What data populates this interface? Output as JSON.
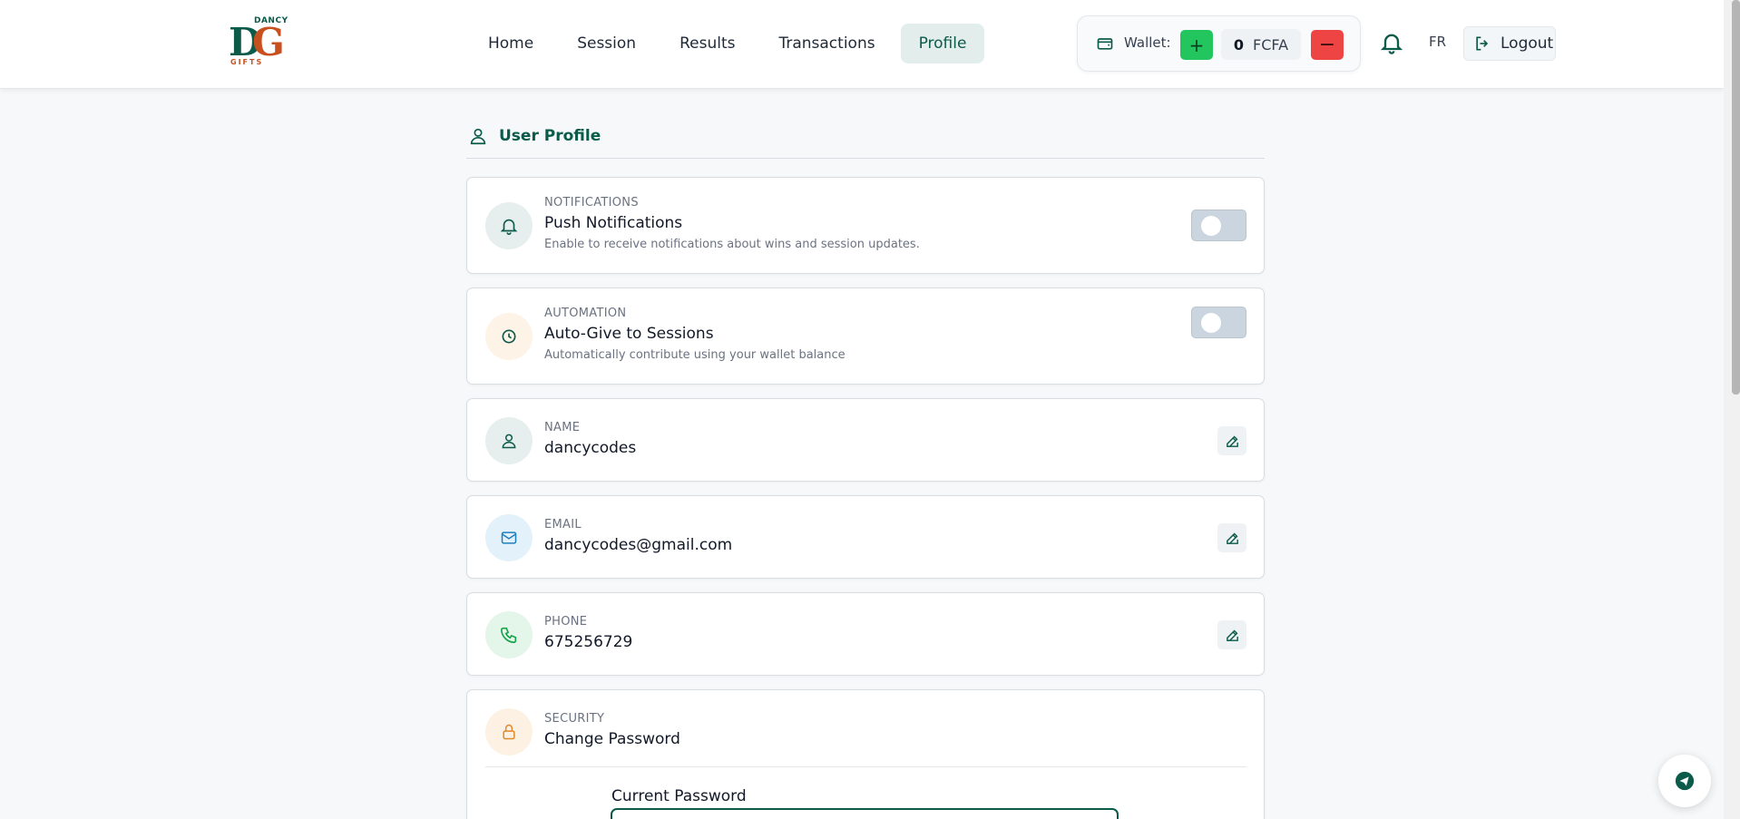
{
  "brand": {
    "top": "DANCY",
    "letter1": "D",
    "letter2": "G",
    "bottom": "GIFTS"
  },
  "nav": {
    "items": [
      {
        "label": "Home"
      },
      {
        "label": "Session"
      },
      {
        "label": "Results"
      },
      {
        "label": "Transactions"
      },
      {
        "label": "Profile"
      }
    ],
    "active": "Profile"
  },
  "wallet": {
    "label": "Wallet:",
    "plus": "+",
    "balance": "0",
    "currency": "FCFA",
    "minus": "−"
  },
  "header": {
    "lang": "FR",
    "logout": "Logout"
  },
  "profile": {
    "title": "User Profile",
    "notifications": {
      "category": "NOTIFICATIONS",
      "title": "Push Notifications",
      "desc": "Enable to receive notifications about wins and session updates.",
      "enabled": false
    },
    "automation": {
      "category": "AUTOMATION",
      "title": "Auto-Give to Sessions",
      "desc": "Automatically contribute using your wallet balance",
      "enabled": false
    },
    "name": {
      "category": "NAME",
      "value": "dancycodes"
    },
    "email": {
      "category": "EMAIL",
      "value": "dancycodes@gmail.com"
    },
    "phone": {
      "category": "PHONE",
      "value": "675256729"
    },
    "security": {
      "category": "SECURITY",
      "title": "Change Password",
      "current_label": "Current Password"
    }
  },
  "colors": {
    "brand": "#0b5a4a",
    "accent": "#c8501e",
    "success": "#22c55e",
    "danger": "#ef4444"
  },
  "icons": [
    "user-icon",
    "bell-icon",
    "clock-icon",
    "mail-icon",
    "phone-icon",
    "lock-icon",
    "edit-icon",
    "wallet-icon",
    "logout-icon",
    "send-icon"
  ]
}
